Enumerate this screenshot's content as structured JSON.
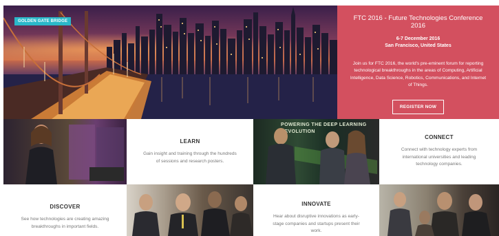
{
  "hero": {
    "badge": "GOLDEN GATE BRIDGE",
    "title": "FTC 2016 - Future Technologies Conference 2016",
    "date": "6-7 December 2016",
    "location": "San Francisco, United States",
    "description": "Join us for FTC 2016, the world's pre-eminent forum for reporting technological breakthroughs in the areas of Computing, Artificial Intelligence, Data Science, Robotics, Communications, and Internet of Things.",
    "register_label": "REGISTER NOW",
    "accent_color": "#d3505f",
    "badge_color": "#2bb8c9"
  },
  "features": {
    "learn": {
      "title": "LEARN",
      "text": "Gain insight and training through the hundreds of sessions and research posters."
    },
    "connect": {
      "title": "CONNECT",
      "text": "Connect with technology experts from international universities and leading technology companies."
    },
    "discover": {
      "title": "DISCOVER",
      "text": "See how technologies are creating amazing breakthroughs in important fields."
    },
    "innovate": {
      "title": "INNOVATE",
      "text": "Hear about disruptive innovations as early-stage companies and startups present their work."
    }
  },
  "photos": {
    "deep_learning_sign": "POWERING THE DEEP LEARNING REVOLUTION"
  }
}
